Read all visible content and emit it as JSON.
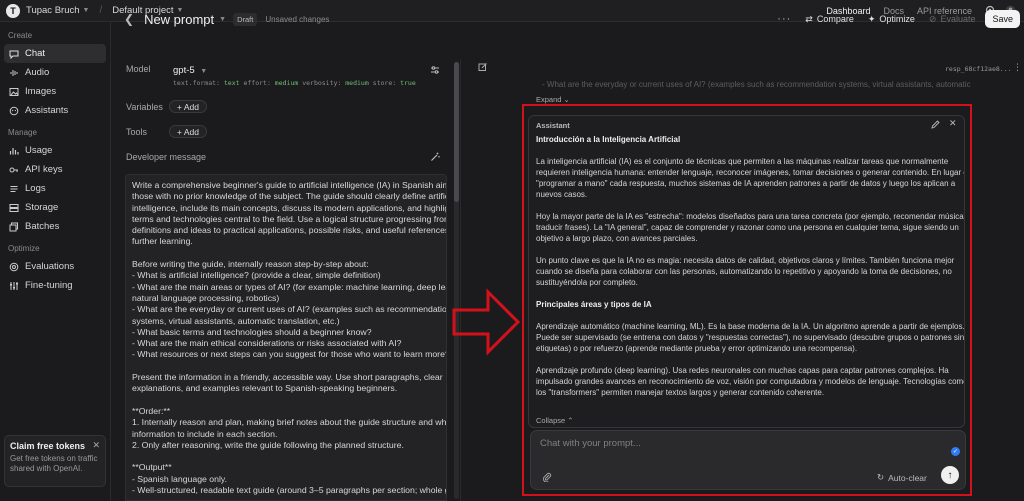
{
  "topbar": {
    "avatar_letter": "T",
    "user_name": "Tupac Bruch",
    "project": "Default project",
    "nav": [
      "Dashboard",
      "Docs",
      "API reference"
    ]
  },
  "sidebar": {
    "sections": [
      {
        "heading": "Create",
        "items": [
          {
            "label": "Chat",
            "icon": "chat-icon",
            "active": true
          },
          {
            "label": "Audio",
            "icon": "audio-icon"
          },
          {
            "label": "Images",
            "icon": "image-icon"
          },
          {
            "label": "Assistants",
            "icon": "assistant-icon"
          }
        ]
      },
      {
        "heading": "Manage",
        "items": [
          {
            "label": "Usage",
            "icon": "usage-icon"
          },
          {
            "label": "API keys",
            "icon": "key-icon"
          },
          {
            "label": "Logs",
            "icon": "logs-icon"
          },
          {
            "label": "Storage",
            "icon": "storage-icon"
          },
          {
            "label": "Batches",
            "icon": "batches-icon"
          }
        ]
      },
      {
        "heading": "Optimize",
        "items": [
          {
            "label": "Evaluations",
            "icon": "evaluations-icon"
          },
          {
            "label": "Fine-tuning",
            "icon": "fine-tuning-icon"
          }
        ]
      }
    ],
    "claim": {
      "title": "Claim free tokens",
      "desc_line1": "Get free tokens on traffic",
      "desc_line2": "shared with OpenAI."
    }
  },
  "header": {
    "title": "New prompt",
    "draft_badge": "Draft",
    "status": "Unsaved changes",
    "compare": "Compare",
    "optimize": "Optimize",
    "evaluate": "Evaluate",
    "save": "Save"
  },
  "config": {
    "model_label": "Model",
    "model_name": "gpt-5",
    "model_meta": [
      {
        "k": "text.format:",
        "v": "text"
      },
      {
        "k": "effort:",
        "v": "medium"
      },
      {
        "k": "verbosity:",
        "v": "medium"
      },
      {
        "k": "store:",
        "v": "true"
      }
    ],
    "variables_label": "Variables",
    "tools_label": "Tools",
    "add_label": "+ Add",
    "developer_label": "Developer message"
  },
  "developer_message": [
    "Write a comprehensive beginner's guide to artificial intelligence (IA) in Spanish aimed at",
    "those with no prior knowledge of the subject. The guide should clearly define artificial",
    "intelligence, include its main concepts, discuss its modern applications, and highlight basic",
    "terms and technologies central to the field. Use a logical structure progressing from basic",
    "definitions and ideas to practical applications, possible risks, and useful references for",
    "further learning.",
    "",
    "Before writing the guide, internally reason step-by-step about:",
    "- What is artificial intelligence? (provide a clear, simple definition)",
    "- What are the main areas or types of AI? (for example: machine learning, deep learning,",
    "natural language processing, robotics)",
    "- What are the everyday or current uses of AI? (examples such as recommendation",
    "systems, virtual assistants, automatic translation, etc.)",
    "- What basic terms and technologies should a beginner know?",
    "- What are the main ethical considerations or risks associated with AI?",
    "- What resources or next steps can you suggest for those who want to learn more?",
    "",
    "Present the information in a friendly, accessible way. Use short paragraphs, clear",
    "explanations, and examples relevant to Spanish-speaking beginners.",
    "",
    "**Order:**",
    "1. Internally reason and plan, making brief notes about the guide structure and what",
    "information to include in each section.",
    "2. Only after reasoning, write the guide following the planned structure.",
    "",
    "**Output**",
    "- Spanish language only.",
    "- Well-structured, readable text guide (around 3–5 paragraphs per section; whole guide"
  ],
  "conversation": {
    "response_id": "resp_68cf12ae8...",
    "faded_prev": "- What are the everyday or current uses of AI? (examples such as recommendation systems, virtual assistants, automatic",
    "expand": "Expand",
    "assistant_label": "Assistant",
    "assistant_lines": [
      {
        "t": "Introducción a la Inteligencia Artificial",
        "b": true
      },
      {
        "t": ""
      },
      {
        "t": "La inteligencia artificial (IA) es el conjunto de técnicas que permiten a las máquinas realizar tareas que normalmente"
      },
      {
        "t": "requieren inteligencia humana: entender lenguaje, reconocer imágenes, tomar decisiones o generar contenido. En lugar de"
      },
      {
        "t": "\"programar a mano\" cada respuesta, muchos sistemas de IA aprenden patrones a partir de datos y luego los aplican a"
      },
      {
        "t": "nuevos casos."
      },
      {
        "t": ""
      },
      {
        "t": "Hoy la mayor parte de la IA es \"estrecha\": modelos diseñados para una tarea concreta (por ejemplo, recomendar música o"
      },
      {
        "t": "traducir frases). La \"IA general\", capaz de comprender y razonar como una persona en cualquier tema, sigue siendo un"
      },
      {
        "t": "objetivo a largo plazo, con avances parciales."
      },
      {
        "t": ""
      },
      {
        "t": "Un punto clave es que la IA no es magia: necesita datos de calidad, objetivos claros y límites. También funciona mejor"
      },
      {
        "t": "cuando se diseña para colaborar con las personas, automatizando lo repetitivo y apoyando la toma de decisiones, no"
      },
      {
        "t": "sustituyéndola por completo."
      },
      {
        "t": ""
      },
      {
        "t": "Principales áreas y tipos de IA",
        "b": true
      },
      {
        "t": ""
      },
      {
        "t": "Aprendizaje automático (machine learning, ML). Es la base moderna de la IA. Un algoritmo aprende a partir de ejemplos."
      },
      {
        "t": "Puede ser supervisado (se entrena con datos y \"respuestas correctas\"), no supervisado (descubre grupos o patrones sin"
      },
      {
        "t": "etiquetas) o por refuerzo (aprende mediante prueba y error optimizando una recompensa)."
      },
      {
        "t": ""
      },
      {
        "t": "Aprendizaje profundo (deep learning). Usa redes neuronales con muchas capas para captar patrones complejos. Ha"
      },
      {
        "t": "impulsado grandes avances en reconocimiento de voz, visión por computadora y modelos de lenguaje. Tecnologías como"
      },
      {
        "t": "los \"transformers\" permiten manejar textos largos y generar contenido coherente."
      }
    ],
    "collapse": "Collapse",
    "chat_placeholder": "Chat with your prompt...",
    "auto_clear": "Auto-clear"
  },
  "colors": {
    "annotation_red": "#d4111a",
    "send_bg": "#f0f0f0",
    "save_bg": "#f3f3f3",
    "badge_blue": "#2f7cf6"
  }
}
